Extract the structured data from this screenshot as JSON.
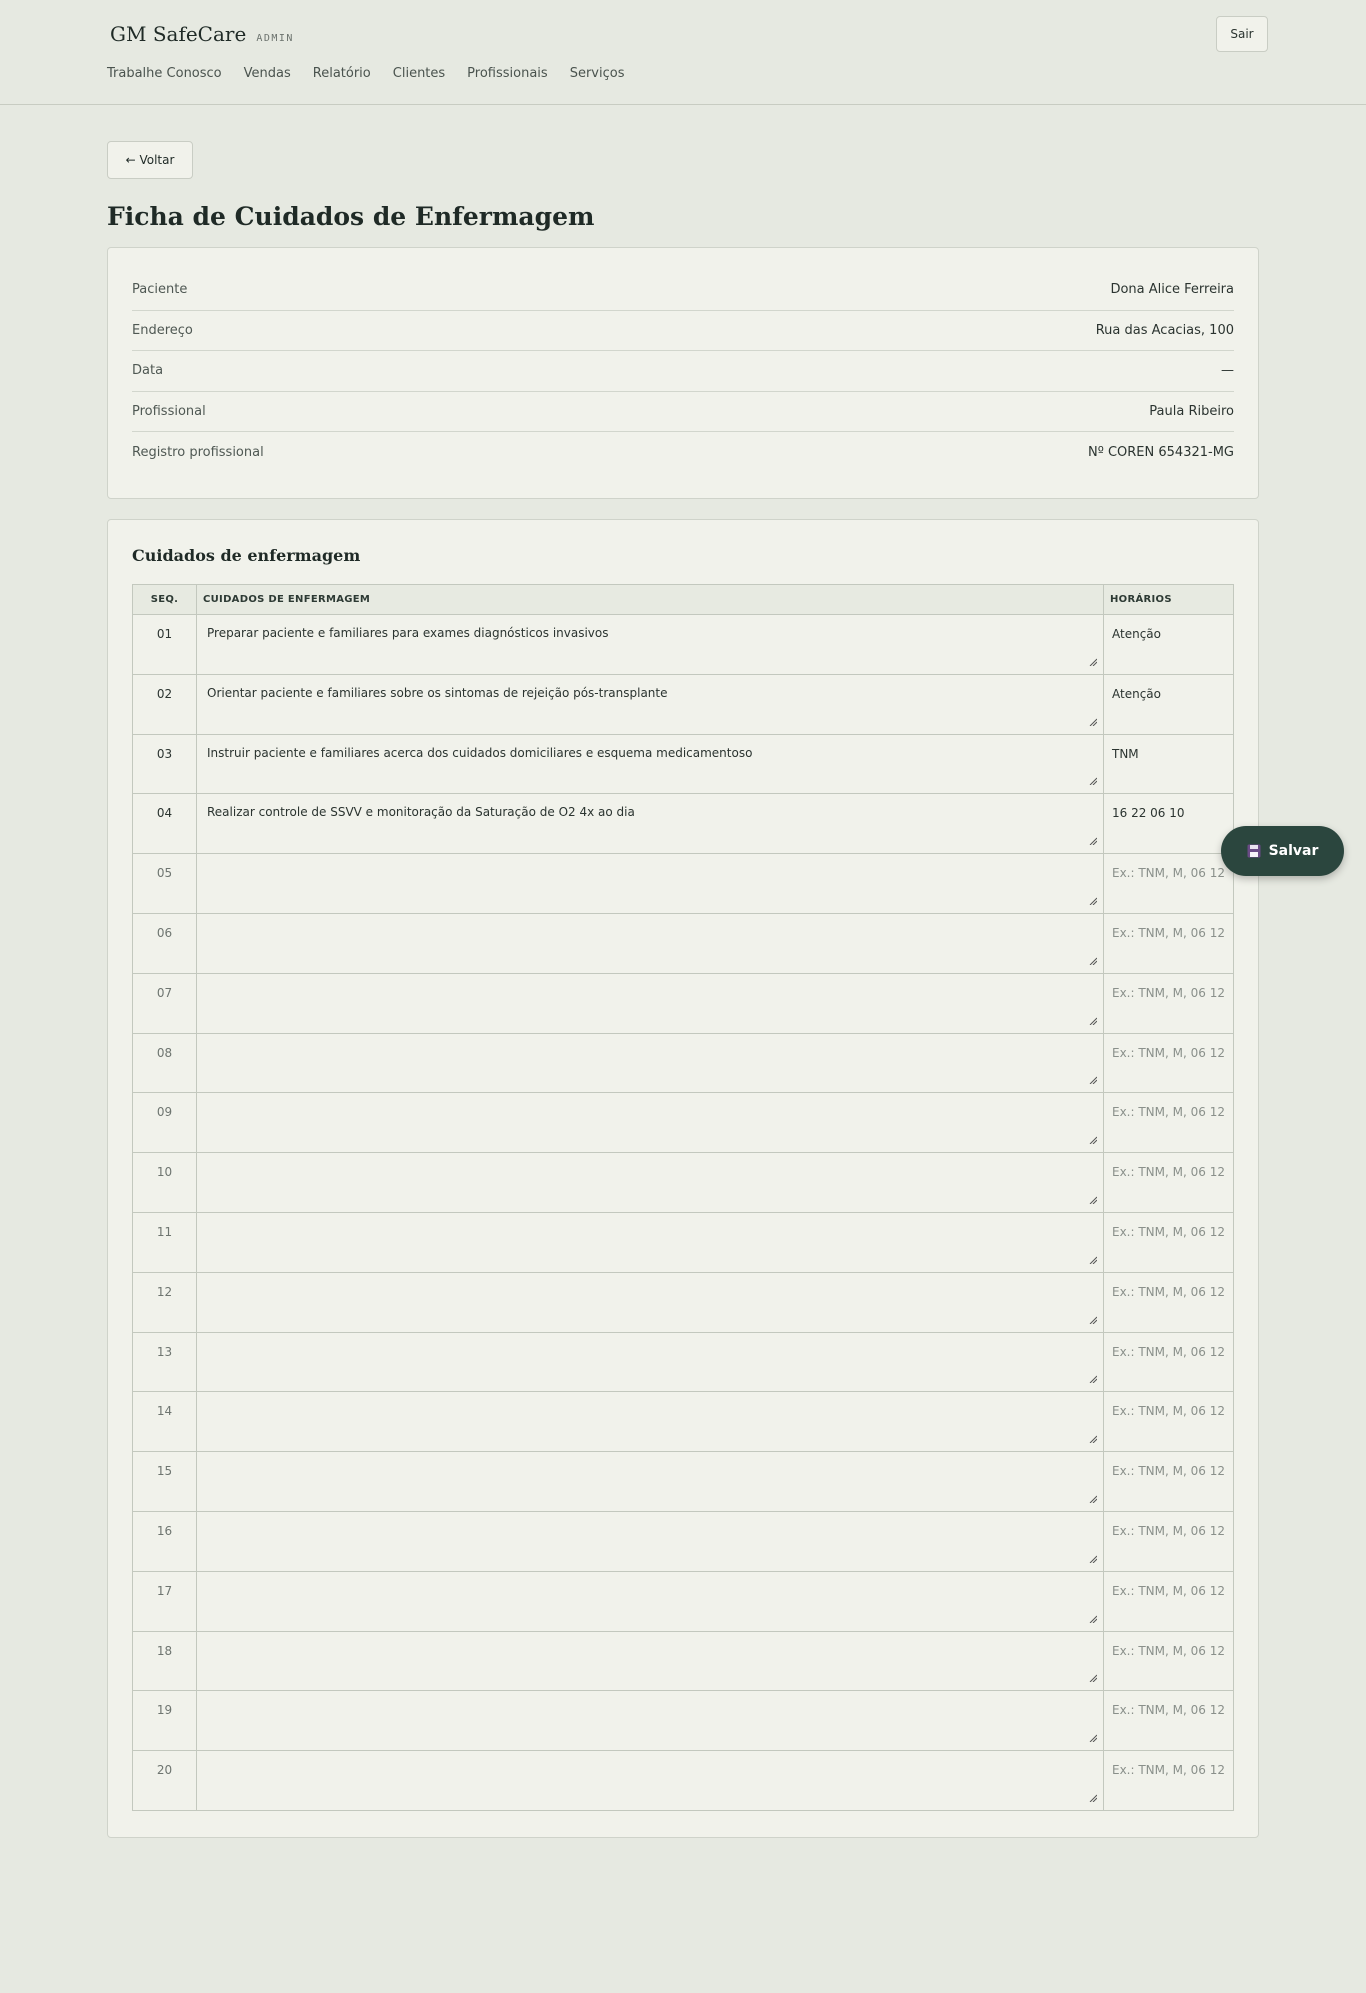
{
  "header": {
    "brand": "GM SafeCare",
    "tag": "ADMIN",
    "nav": [
      "Trabalhe Conosco",
      "Vendas",
      "Relatório",
      "Clientes",
      "Profissionais",
      "Serviços"
    ],
    "logout_label": "Sair"
  },
  "back_label": "← Voltar",
  "page_title": "Ficha de Cuidados de Enfermagem",
  "info": [
    {
      "label": "Paciente",
      "value": "Dona Alice Ferreira"
    },
    {
      "label": "Endereço",
      "value": "Rua das Acacias, 100"
    },
    {
      "label": "Data",
      "value": "—"
    },
    {
      "label": "Profissional",
      "value": "Paula Ribeiro"
    },
    {
      "label": "Registro profissional",
      "value": "Nº COREN 654321-MG"
    }
  ],
  "care": {
    "title": "Cuidados de enfermagem",
    "columns": {
      "seq": "SEQ.",
      "care": "CUIDADOS DE ENFERMAGEM",
      "hours": "HORÁRIOS"
    },
    "hours_placeholder": "Ex.: TNM, M, 06 12",
    "rows": [
      {
        "seq": "01",
        "care": "Preparar paciente e familiares para exames diagnósticos invasivos",
        "hours": "Atenção"
      },
      {
        "seq": "02",
        "care": "Orientar paciente e familiares sobre os sintomas de rejeição pós-transplante",
        "hours": "Atenção"
      },
      {
        "seq": "03",
        "care": "Instruir paciente e familiares acerca dos cuidados domiciliares e esquema medicamentoso",
        "hours": "TNM"
      },
      {
        "seq": "04",
        "care": "Realizar controle de SSVV e monitoração da Saturação de O2 4x ao dia",
        "hours": "16 22 06 10"
      },
      {
        "seq": "05",
        "care": "",
        "hours": ""
      },
      {
        "seq": "06",
        "care": "",
        "hours": ""
      },
      {
        "seq": "07",
        "care": "",
        "hours": ""
      },
      {
        "seq": "08",
        "care": "",
        "hours": ""
      },
      {
        "seq": "09",
        "care": "",
        "hours": ""
      },
      {
        "seq": "10",
        "care": "",
        "hours": ""
      },
      {
        "seq": "11",
        "care": "",
        "hours": ""
      },
      {
        "seq": "12",
        "care": "",
        "hours": ""
      },
      {
        "seq": "13",
        "care": "",
        "hours": ""
      },
      {
        "seq": "14",
        "care": "",
        "hours": ""
      },
      {
        "seq": "15",
        "care": "",
        "hours": ""
      },
      {
        "seq": "16",
        "care": "",
        "hours": ""
      },
      {
        "seq": "17",
        "care": "",
        "hours": ""
      },
      {
        "seq": "18",
        "care": "",
        "hours": ""
      },
      {
        "seq": "19",
        "care": "",
        "hours": ""
      },
      {
        "seq": "20",
        "care": "",
        "hours": ""
      }
    ]
  },
  "save_label": "Salvar",
  "icons": {
    "save": "floppy-disk-icon",
    "resize": "resize-handle-icon"
  }
}
